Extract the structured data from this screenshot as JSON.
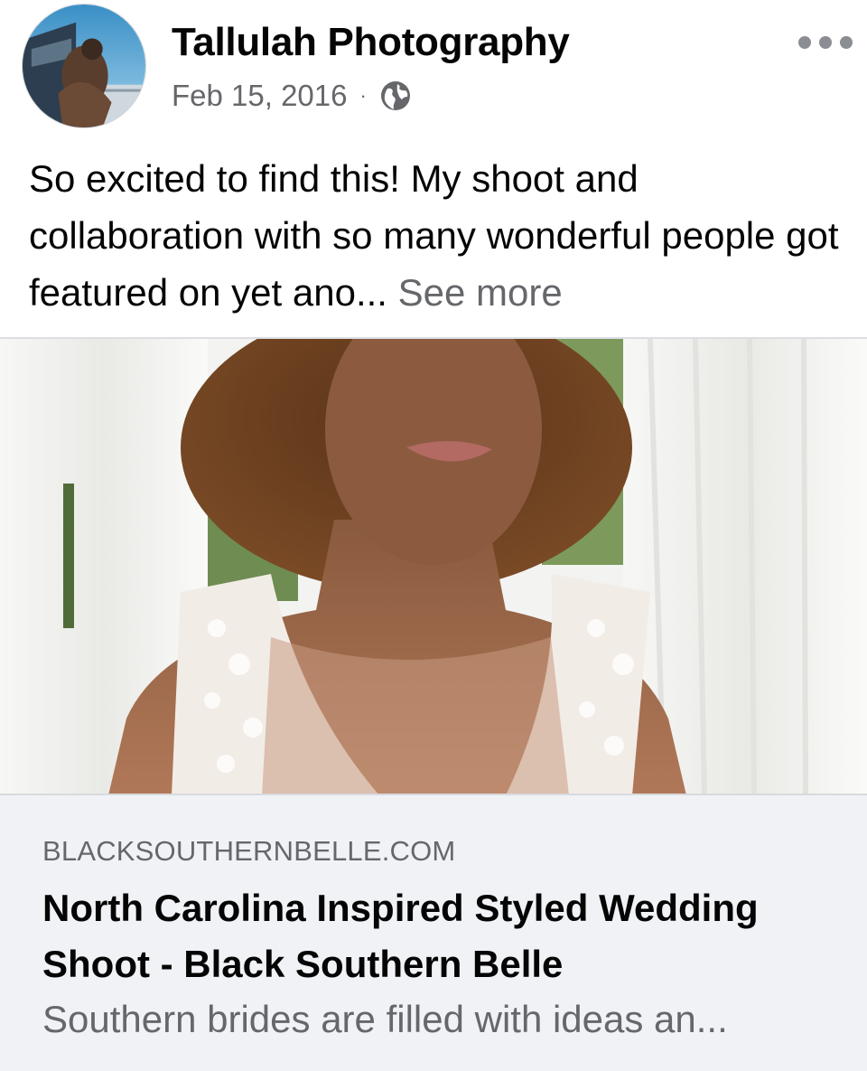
{
  "post": {
    "author": "Tallulah Photography",
    "date": "Feb 15, 2016",
    "separator": "·",
    "audience_icon": "globe-icon",
    "avatar_icon": "avatar-photo",
    "more_icon": "more-options-icon",
    "text": "So excited to find this! My shoot and collaboration with so many wonderful people got featured on yet ano",
    "ellipsis": "...",
    "see_more": "See more"
  },
  "link_preview": {
    "image": "bride-portrait-photo",
    "domain": "BLACKSOUTHERNBELLE.COM",
    "title": "North Carolina Inspired Styled Wedding Shoot - Black Southern Belle",
    "description": "Southern brides are filled with ideas an..."
  },
  "colors": {
    "primary_text": "#050505",
    "secondary_text": "#65676b",
    "card_background": "#f0f2f5"
  }
}
